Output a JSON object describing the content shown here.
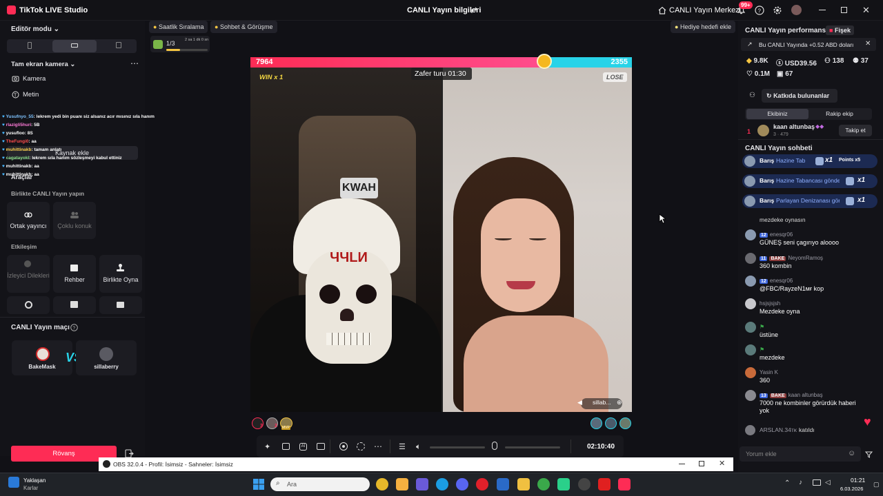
{
  "app": {
    "title": "TikTok LIVE Studio",
    "center_title": "CANLI Yayın bilgileri",
    "live_center": "CANLI Yayın Merkezi",
    "notif_badge": "99+"
  },
  "left": {
    "editor_mode": "Editör modu",
    "camera_section": "Tam ekran kamera",
    "camera": "Kamera",
    "text": "Metin",
    "add_source": "Kaynak ekle",
    "tools_title": "Araçlar",
    "collab_title": "Birlikte CANLI Yayın yapın",
    "co_host": "Ortak yayıncı",
    "multi_guest": "Çoklu konuk",
    "interaction_title": "Etkileşim",
    "viewer_requests": "İzleyici Dilekleri",
    "guide": "Rehber",
    "play_together": "Birlikte Oyna",
    "match_title": "CANLI Yayın maçı",
    "player1": "BakeMask",
    "player2": "sillaberry",
    "rematch": "Rövanş",
    "overlay_chat": [
      {
        "name": "Yusufnyo_55",
        "text": ": lekrem yedi bin puanı siz alsanız acır mısınız sıla hanım",
        "color": "#7ec3ff"
      },
      {
        "name": "rlazigli5huri",
        "text": ": 5B",
        "color": "#ff7ad9"
      },
      {
        "name": "yusufloo",
        "text": ": 8S",
        "color": "#ffffff"
      },
      {
        "name": "TheFungi0",
        "text": ": aa",
        "color": "#ff4d4d"
      },
      {
        "name": "muhittinakb",
        "text": ": tamam anlatı",
        "color": "#ffd24d"
      },
      {
        "name": "cagatayokl",
        "text": ": lekrem sıla hanım sözleşmeyi kabul ettiniz",
        "color": "#8be08b"
      },
      {
        "name": "muhittinakb",
        "text": ": aa",
        "color": "#ffffff"
      },
      {
        "name": "muhittinakb",
        "text": ": aa",
        "color": "#ffffff"
      }
    ]
  },
  "center": {
    "hourly_rank": "Saatlik Sıralama",
    "chat_meet": "Sohbet & Görüşme",
    "gift_goal": "Hediye hedefi ekle",
    "goal_progress": "1/3",
    "goal_time": "2 sa 1 dk 0 sn",
    "goal_fill": 0.33,
    "score_left": "7964",
    "score_right": "2355",
    "score_left_fraction": 0.77,
    "round_label": "Zafer turu 01:30",
    "win_label": "WIN x 1",
    "lose_label": "LOSE",
    "opponent_tag": "sillab...",
    "timer": "02:10:40",
    "left_gifter_count": "3",
    "left_gifter2_count": "2",
    "mvp_label": "MVP"
  },
  "right": {
    "perf_title": "CANLI Yayın performansı",
    "firecracker": "Fişek",
    "earning_note": "Bu CANLI Yayında +0.52 ABD doları",
    "diamonds": "9.8K",
    "usd": "USD39.56",
    "viewers": "138",
    "new_followers": "37",
    "likes": "0.1M",
    "gifts": "67",
    "contributors": "Katkıda bulunanlar",
    "team_tab": "Ekibiniz",
    "opp_tab": "Rakip ekip",
    "top_rank": "1",
    "top_name": "kaan altunbaş",
    "top_sub": "3 · 479",
    "follow_team": "Takip et",
    "chat_title": "CANLI Yayın sohbeti",
    "gifts_feed": [
      {
        "name": "Barış",
        "text": "Hazine Tab",
        "mult": "x1",
        "extra": "Points x5"
      },
      {
        "name": "Barış",
        "text": "Hazine Tabancası gönde",
        "mult": "x1",
        "extra": ""
      },
      {
        "name": "Barış",
        "text": "Parlayan Denizanası gön",
        "mult": "x1",
        "extra": ""
      }
    ],
    "partial_msg": "mezdeke oynasın",
    "messages": [
      {
        "level": "12",
        "name": "enesqr06",
        "badge": "",
        "text": "GÜNEŞ seni çagırıyo aloooo"
      },
      {
        "level": "11",
        "name": "NeyomRamoş",
        "badge": "BAKE",
        "text": "360 kombin"
      },
      {
        "level": "12",
        "name": "enesqr06",
        "badge": "",
        "text": "@FBC/RayzeN1ᴍғ kop"
      },
      {
        "level": "",
        "name": "hsjsjsjsh",
        "badge": "",
        "text": "Mezdeke oyna"
      },
      {
        "level": "",
        "name": "",
        "badge": "",
        "text": "üstüne"
      },
      {
        "level": "",
        "name": "",
        "badge": "",
        "text": "mezdeke"
      },
      {
        "level": "",
        "name": "Yasin K",
        "badge": "",
        "text": "360"
      },
      {
        "level": "13",
        "name": "kaan altunbaş",
        "badge": "BAKE",
        "text": "7000 ne kombinler görürdük haberi yok"
      }
    ],
    "join_name": "ARSLAN.34ᴛᴋ",
    "join_text": "katıldı",
    "comment_placeholder": "Yorum ekle"
  },
  "obs": {
    "title": "OBS 32.0.4 - Profil: İsimsiz - Sahneler: İsimsiz"
  },
  "taskbar": {
    "weather_title": "Yaklaşan",
    "weather_sub": "Karlar",
    "search": "Ara",
    "time": "01:21",
    "date": "6.03.2026"
  },
  "colors": {
    "accent": "#fe2c55",
    "score_right": "#28d3e8",
    "team_blue": "#3a62d8"
  }
}
